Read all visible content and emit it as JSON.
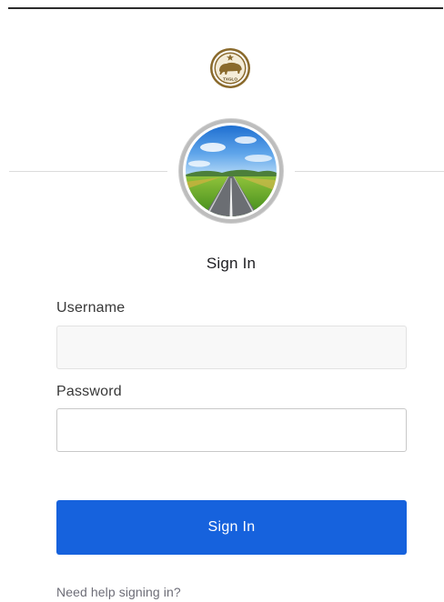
{
  "header": {
    "logo_text": "TXGLO",
    "logo_icon": "bison-seal-icon"
  },
  "avatar": {
    "icon": "road-landscape-image"
  },
  "form": {
    "title": "Sign In",
    "username_label": "Username",
    "username_value": "",
    "password_label": "Password",
    "password_value": "",
    "submit_label": "Sign In",
    "help_link": "Need help signing in?"
  },
  "colors": {
    "primary": "#1662dd",
    "logo_gold": "#8a6a2c",
    "text": "#1d1d21",
    "muted": "#6e6e78"
  }
}
